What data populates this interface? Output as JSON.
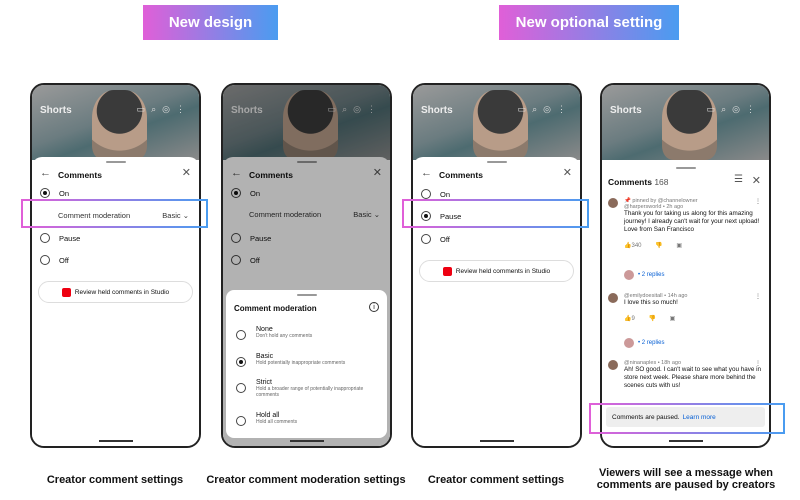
{
  "headers": {
    "left": "New design",
    "right": "New optional setting"
  },
  "video": {
    "label": "Shorts"
  },
  "sheet": {
    "title": "Comments",
    "options": {
      "on": "On",
      "pause": "Pause",
      "off": "Off"
    },
    "moderation_label": "Comment moderation",
    "moderation_value": "Basic",
    "studio_button": "Review held comments in Studio"
  },
  "modal": {
    "title": "Comment moderation",
    "options": [
      {
        "label": "None",
        "sub": "Don't hold any comments"
      },
      {
        "label": "Basic",
        "sub": "Hold potentially inappropriate comments"
      },
      {
        "label": "Strict",
        "sub": "Hold a broader range of potentially inappropriate comments"
      },
      {
        "label": "Hold all",
        "sub": "Hold all comments"
      }
    ]
  },
  "viewer": {
    "title": "Comments",
    "count": "168",
    "comments": [
      {
        "pinned": "pinned by @channelowner",
        "author": "@harpersworld • 2h ago",
        "text": "Thank you for taking us along for this amazing journey! I already can't wait for your next upload! Love from San Francisco",
        "likes": "340",
        "replies": "• 2 replies"
      },
      {
        "author": "@emilydoesitall • 14h ago",
        "text": "I love this so much!",
        "likes": "9",
        "replies": "• 2 replies"
      },
      {
        "author": "@ninanaples • 18h ago",
        "text": "Ah! SO good. I can't wait to see what you have in store next week. Please share more behind the scenes cuts with us!"
      }
    ],
    "paused_text": "Comments are paused.",
    "learn_more": "Learn more"
  },
  "captions": [
    "Creator comment settings",
    "Creator comment moderation settings",
    "Creator comment settings",
    "Viewers will see a message when comments are paused by creators"
  ],
  "colors": {
    "gradient_start": "#e05fd8",
    "gradient_end": "#4a9cf0",
    "link": "#065fd4"
  }
}
